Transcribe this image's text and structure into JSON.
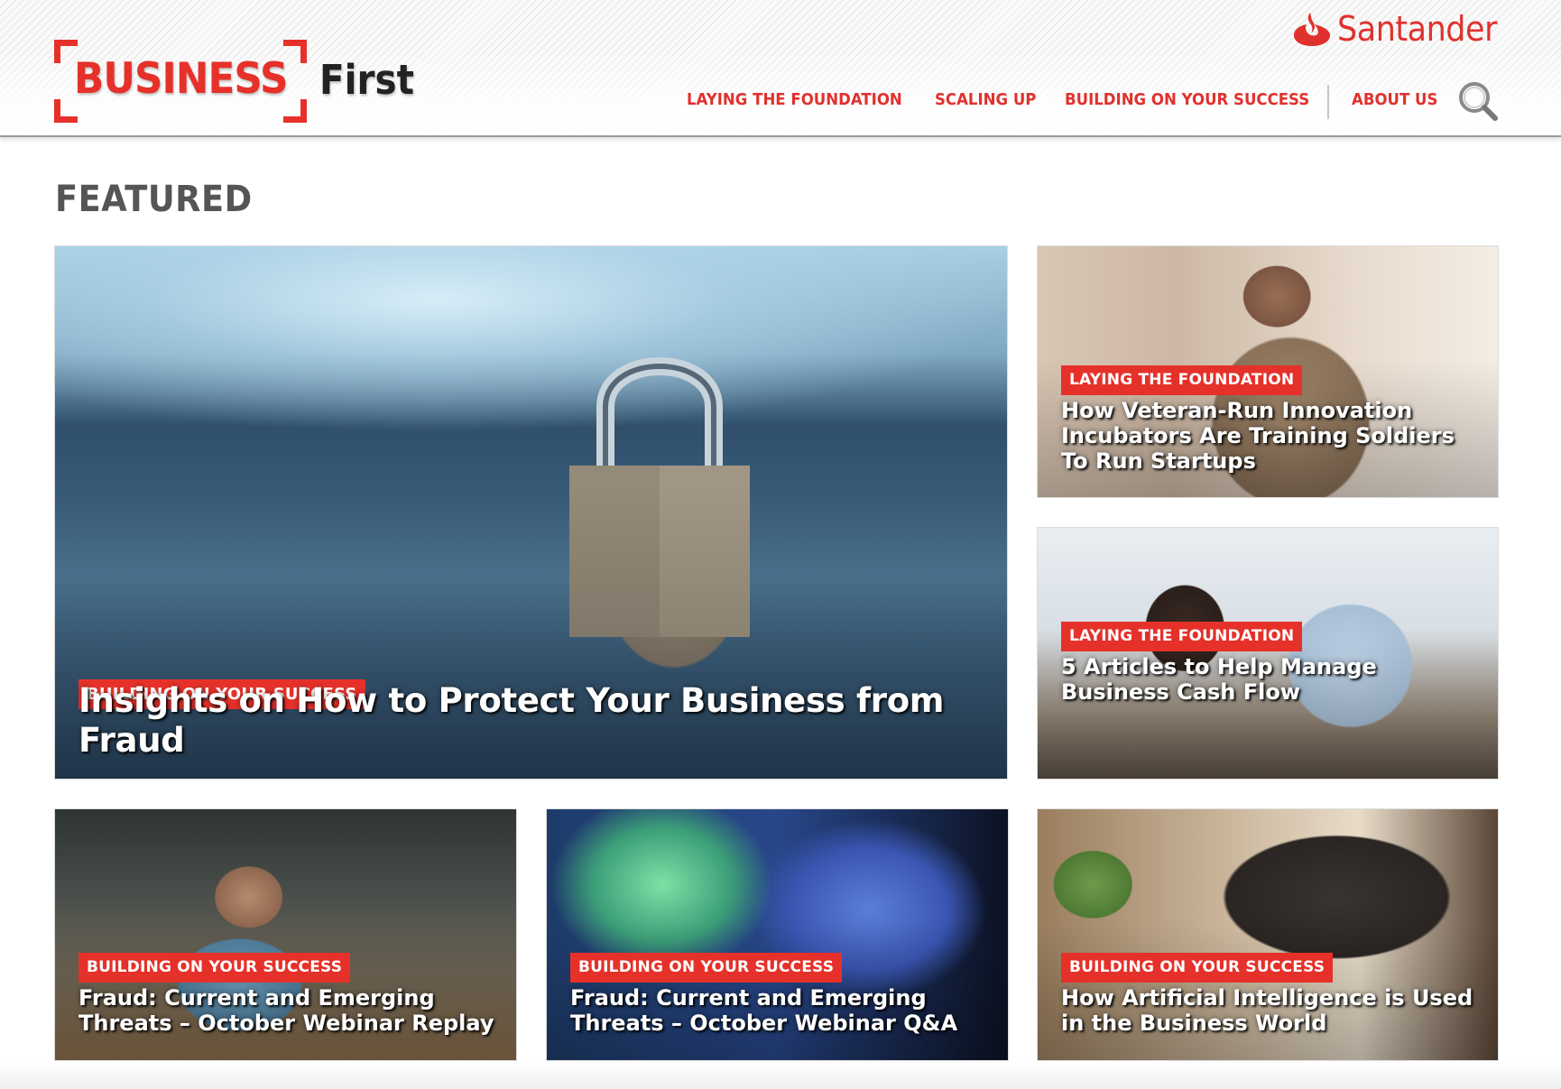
{
  "header": {
    "logo": {
      "business": "BUSINESS",
      "first": "First"
    },
    "brand": {
      "name": "Santander",
      "icon": "santander-flame-icon"
    },
    "nav": [
      {
        "label": "LAYING THE FOUNDATION"
      },
      {
        "label": "SCALING UP"
      },
      {
        "label": "BUILDING ON YOUR SUCCESS"
      },
      {
        "label": "ABOUT US"
      }
    ],
    "search_icon": "magnifying-glass-icon"
  },
  "featured": {
    "title": "FEATURED",
    "cards": [
      {
        "tag": "BUILDING ON YOUR SUCCESS",
        "title": "Insights on How to Protect Your Business from Fraud",
        "image": "padlock on keyboard"
      },
      {
        "tag": "LAYING THE FOUNDATION",
        "title": "How Veteran-Run Innovation Incubators Are Training Soldiers To Run Startups",
        "image": "soldier at laptop"
      },
      {
        "tag": "LAYING THE FOUNDATION",
        "title": "5 Articles to Help Manage Business Cash Flow",
        "image": "two people with tablet"
      },
      {
        "tag": "BUILDING ON YOUR SUCCESS",
        "title": "Fraud: Current and Emerging Threats – October Webinar Replay",
        "image": "man at desk with tablet"
      },
      {
        "tag": "BUILDING ON YOUR SUCCESS",
        "title": "Fraud: Current and Emerging Threats – October Webinar Q&A",
        "image": "hands typing with digital overlay"
      },
      {
        "tag": "BUILDING ON YOUR SUCCESS",
        "title": "How Artificial Intelligence is Used in the Business World",
        "image": "laptop with plant and glasses"
      }
    ]
  },
  "colors": {
    "brand_red": "#e5312a",
    "heading_gray": "#555555"
  }
}
